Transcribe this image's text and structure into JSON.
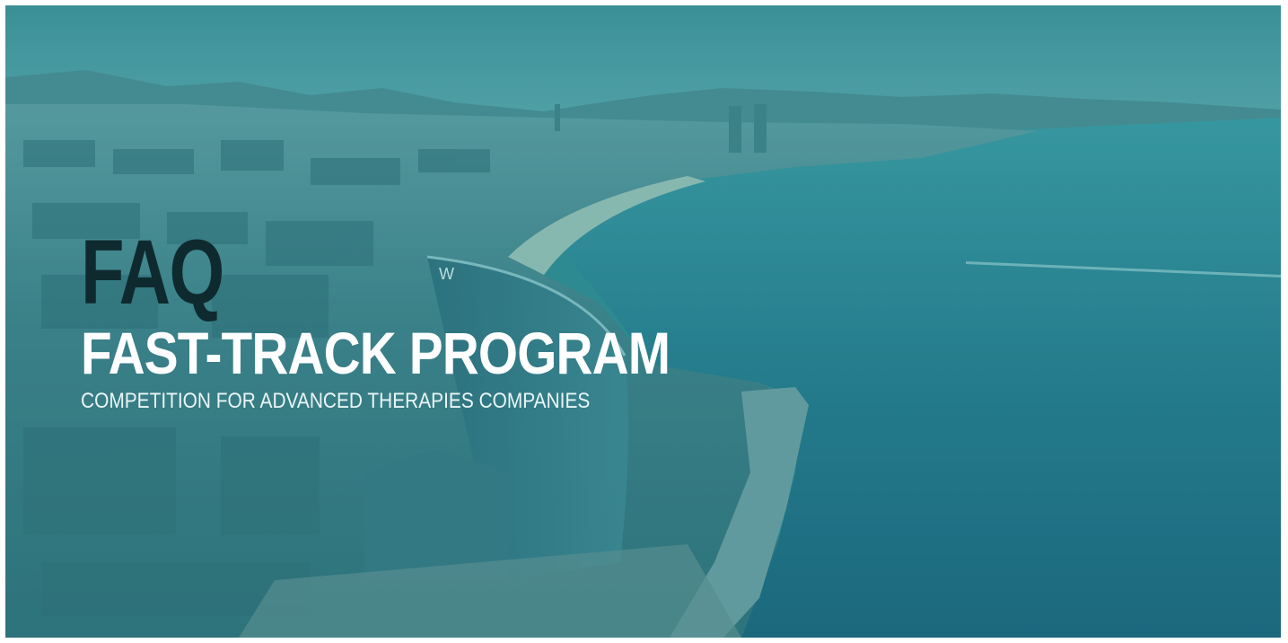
{
  "hero": {
    "heading": "FAQ",
    "title": "FAST-TRACK PROGRAM",
    "subtitle": "COMPETITION FOR ADVANCED THERAPIES COMPANIES",
    "hotel_sign": "W"
  },
  "colors": {
    "overlay_tint": "#2f8a90",
    "sea": "#1f6f7c",
    "sky": "#4f9ea4",
    "heading_dark": "#0f2a2f",
    "title_white": "#ffffff"
  },
  "image": {
    "subject": "aerial-city-coastline-photo"
  }
}
